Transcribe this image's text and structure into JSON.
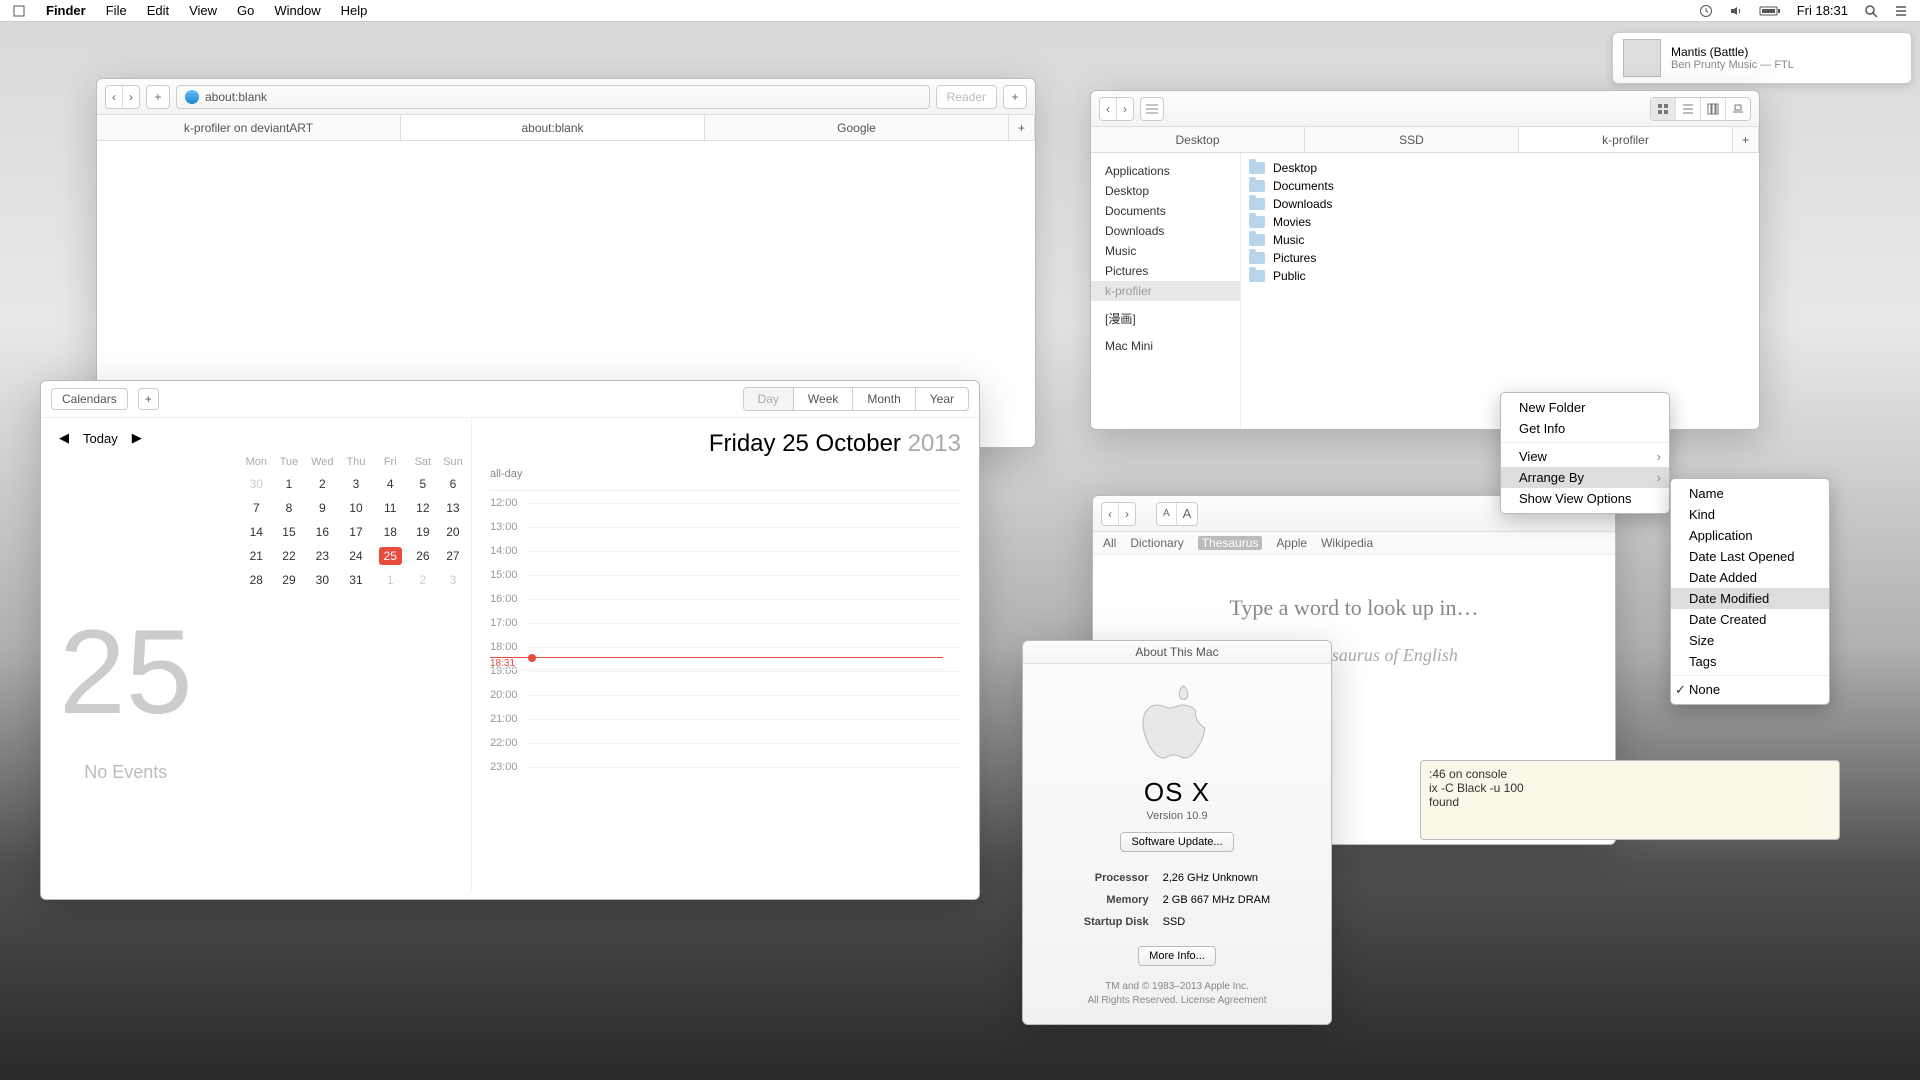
{
  "menubar": {
    "app": "Finder",
    "items": [
      "File",
      "Edit",
      "View",
      "Go",
      "Window",
      "Help"
    ],
    "clock": "Fri 18:31"
  },
  "notification": {
    "title": "Mantis (Battle)",
    "subtitle": "Ben Prunty Music — FTL"
  },
  "safari": {
    "url": "about:blank",
    "reader": "Reader",
    "tabs": [
      "k-profiler on deviantART",
      "about:blank",
      "Google"
    ],
    "active_tab": 1
  },
  "finder": {
    "view_tabs": [
      "Desktop",
      "SSD",
      "k-profiler"
    ],
    "active_view_tab": 2,
    "sidebar": [
      "Applications",
      "Desktop",
      "Documents",
      "Downloads",
      "Music",
      "Pictures",
      "k-profiler",
      "",
      "[漫画]",
      "",
      "Mac Mini"
    ],
    "sidebar_selected": 6,
    "files": [
      "Desktop",
      "Documents",
      "Downloads",
      "Movies",
      "Music",
      "Pictures",
      "Public"
    ]
  },
  "calendar": {
    "calbtn": "Calendars",
    "segments": [
      "Day",
      "Week",
      "Month",
      "Year"
    ],
    "active_seg": 0,
    "today": "Today",
    "title_prefix": "Friday 25 October",
    "title_year": "2013",
    "dow": [
      "Mon",
      "Tue",
      "Wed",
      "Thu",
      "Fri",
      "Sat",
      "Sun"
    ],
    "grid": [
      [
        "30",
        "1",
        "2",
        "3",
        "4",
        "5",
        "6"
      ],
      [
        "7",
        "8",
        "9",
        "10",
        "11",
        "12",
        "13"
      ],
      [
        "14",
        "15",
        "16",
        "17",
        "18",
        "19",
        "20"
      ],
      [
        "21",
        "22",
        "23",
        "24",
        "25",
        "26",
        "27"
      ],
      [
        "28",
        "29",
        "30",
        "31",
        "1",
        "2",
        "3"
      ]
    ],
    "today_cell": [
      3,
      4
    ],
    "dim_cells": [
      [
        0,
        0
      ],
      [
        4,
        4
      ],
      [
        4,
        5
      ],
      [
        4,
        6
      ]
    ],
    "bignum": "25",
    "noevents": "No Events",
    "allday": "all-day",
    "hours": [
      "12:00",
      "13:00",
      "14:00",
      "15:00",
      "16:00",
      "17:00",
      "18:00",
      "19:00",
      "20:00",
      "21:00",
      "22:00",
      "23:00"
    ],
    "now_label": "18:31",
    "now_index_after": 6
  },
  "about": {
    "title": "About This Mac",
    "os": "OS X",
    "version": "Version 10.9",
    "swupdate": "Software Update...",
    "rows": [
      [
        "Processor",
        "2,26 GHz Unknown"
      ],
      [
        "Memory",
        "2 GB 667 MHz DRAM"
      ],
      [
        "Startup Disk",
        "SSD"
      ]
    ],
    "moreinfo": "More Info...",
    "foot1": "TM and © 1983–2013 Apple Inc.",
    "foot2": "All Rights Reserved.   License Agreement"
  },
  "dictionary": {
    "sources": [
      "All",
      "Dictionary",
      "Thesaurus",
      "Apple",
      "Wikipedia"
    ],
    "active_source": 2,
    "prompt": "Type a word to look up in…",
    "source_label": "Oxford Thesaurus of English"
  },
  "ctx1": {
    "items": [
      "New Folder",
      "Get Info",
      "—",
      "View",
      "Arrange By",
      "Show View Options"
    ],
    "hi": 4,
    "subs": [
      3,
      4
    ]
  },
  "ctx2": {
    "items": [
      "Name",
      "Kind",
      "Application",
      "Date Last Opened",
      "Date Added",
      "Date Modified",
      "Date Created",
      "Size",
      "Tags",
      "—",
      "None"
    ],
    "hi": 5,
    "checked": 10
  },
  "terminal": {
    "lines": [
      ":46 on console",
      "ix -C Black -u 100",
      "found"
    ]
  }
}
